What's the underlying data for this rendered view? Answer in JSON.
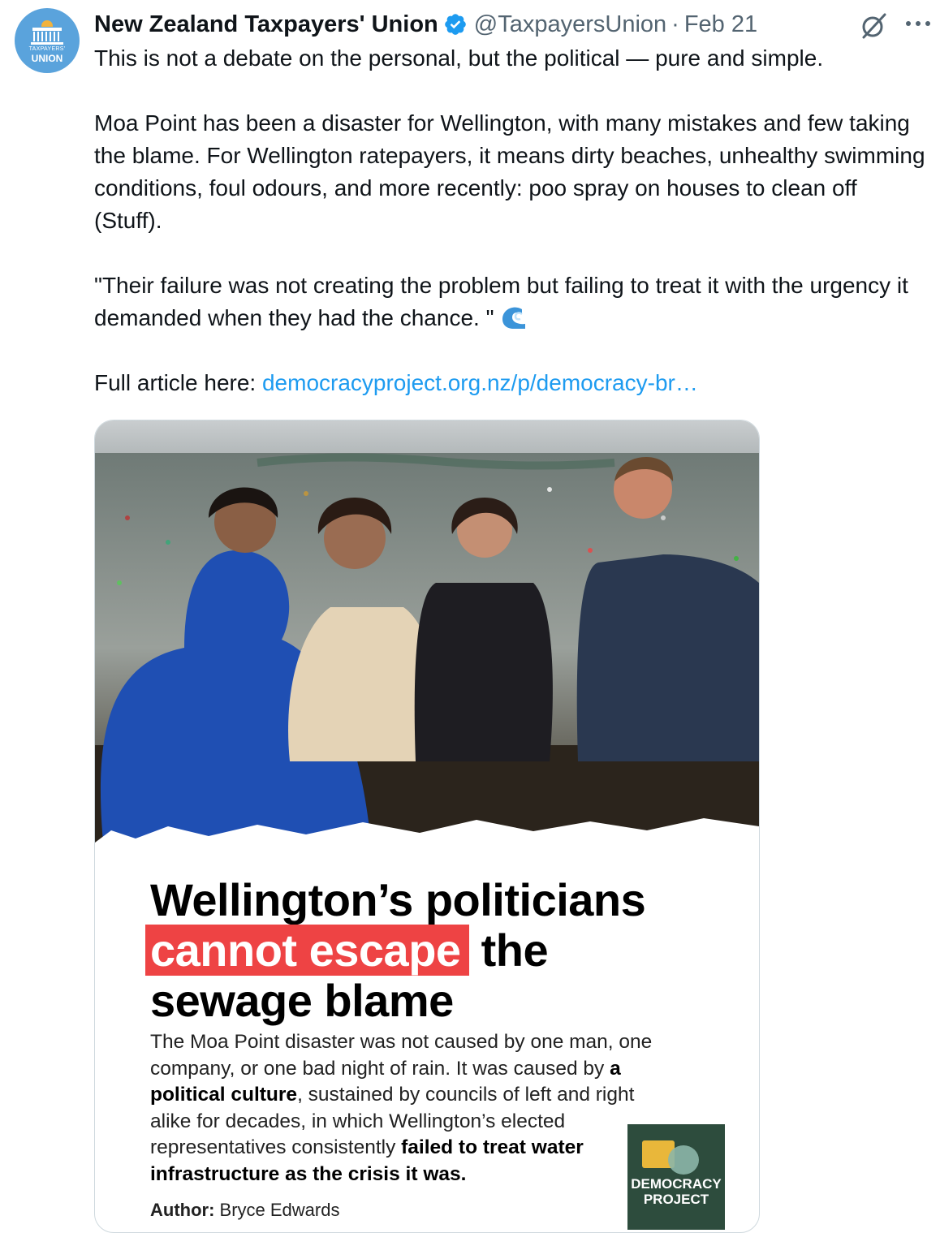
{
  "tweet": {
    "author_name": "New Zealand Taxpayers' Union",
    "handle": "@TaxpayersUnion",
    "separator": "·",
    "date": "Feb 21",
    "avatar": {
      "line1": "TAXPAYERS'",
      "line2": "UNION"
    },
    "paragraphs": [
      "This is not a debate on the personal, but the political — pure and simple.",
      "Moa Point has been a disaster for Wellington, with many mistakes and few taking the blame. For Wellington ratepayers, it means dirty beaches, unhealthy swimming conditions, foul odours, and more recently: poo spray on houses to clean off (Stuff).",
      "\"Their failure was not creating the problem but failing to treat it with the urgency it demanded when they had the chance. \""
    ],
    "wave_emoji": "wave-emoji",
    "link_prefix": "Full article here: ",
    "link_text": "democracyproject.org.nz/p/democracy-br…"
  },
  "card": {
    "headline_line1": "Wellington’s politicians",
    "headline_highlight": "cannot escape",
    "headline_rest": " the",
    "headline_line3": "sewage blame",
    "excerpt_1": "The Moa Point disaster was not caused by one man, one company, or one bad night of rain. It was caused by ",
    "excerpt_bold_1": "a political culture",
    "excerpt_2": ", sustained by councils of left and right alike for decades, in which Wellington’s elected representatives consistently ",
    "excerpt_bold_2": "failed to treat water infrastructure as the crisis it was.",
    "author_label": "Author:",
    "author_name": " Bryce Edwards",
    "logo_line1": "DEMOCRACY",
    "logo_line2": "PROJECT"
  },
  "colors": {
    "link": "#1d9bf0",
    "verified": "#1d9bf0",
    "highlight": "#ee4344",
    "logo_bg": "#2d4c3d"
  },
  "icons": [
    "verified-badge-icon",
    "grok-icon",
    "more-icon",
    "wave-emoji"
  ]
}
